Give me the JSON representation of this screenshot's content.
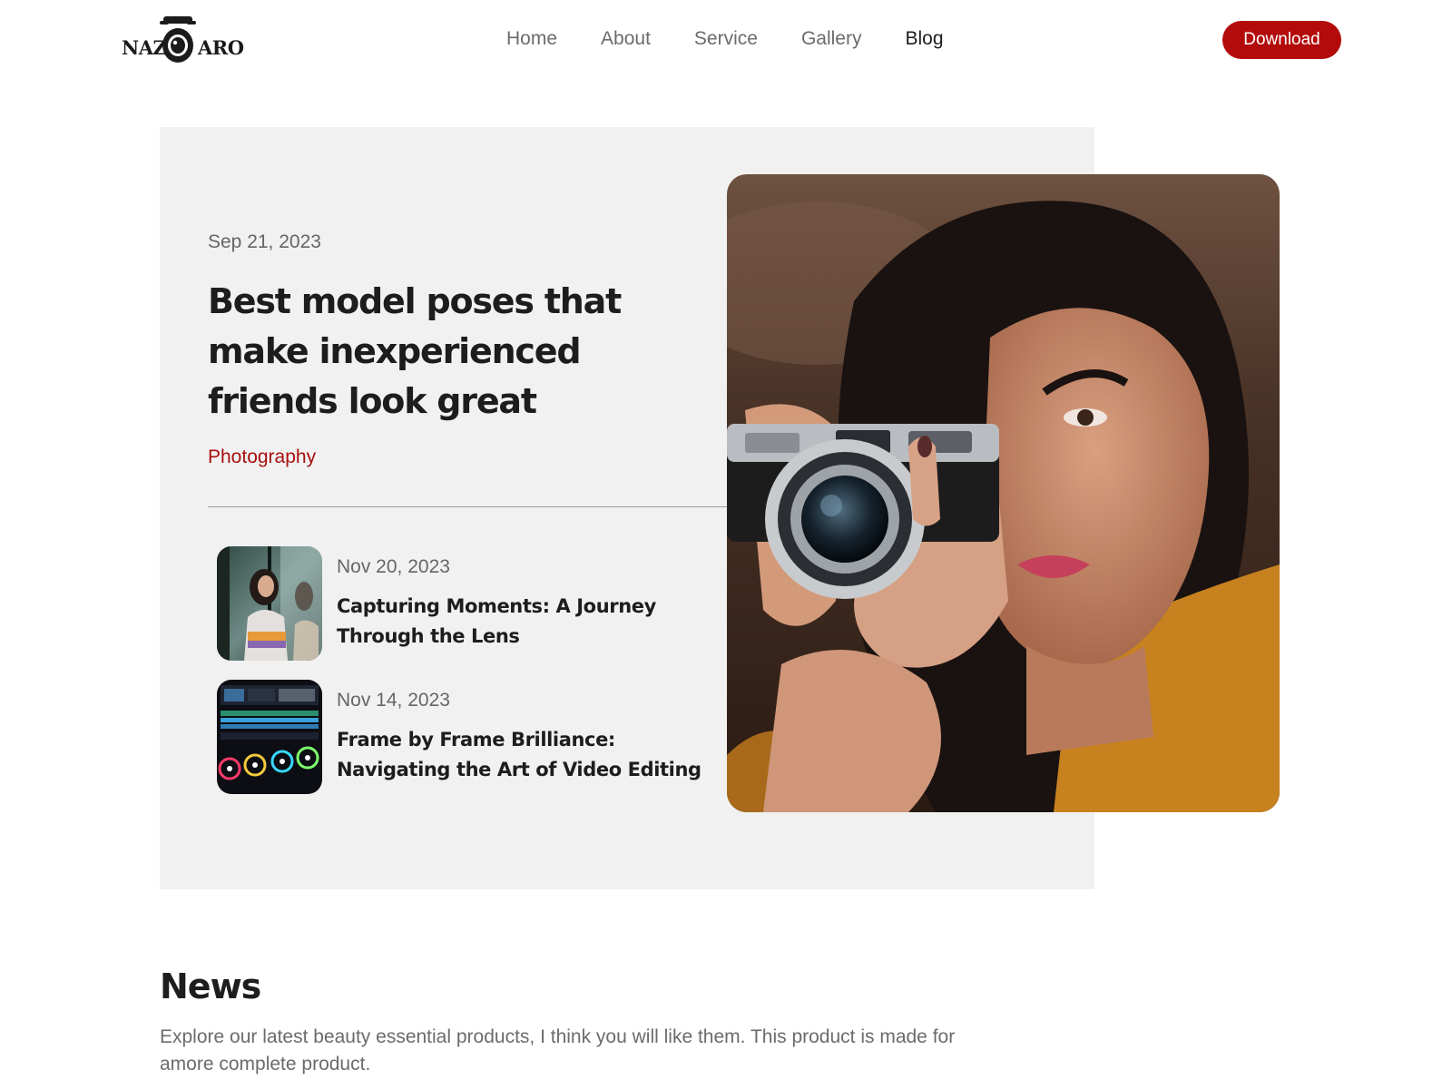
{
  "brand": {
    "logo_left": "NAZ",
    "logo_right": "ARO"
  },
  "nav": {
    "items": [
      {
        "label": "Home"
      },
      {
        "label": "About"
      },
      {
        "label": "Service"
      },
      {
        "label": "Gallery"
      },
      {
        "label": "Blog",
        "active": true
      }
    ],
    "download_label": "Download"
  },
  "hero": {
    "date": "Sep 21, 2023",
    "title": "Best model poses that make inexperienced friends look great",
    "category": "Photography",
    "image_icon": "woman-with-camera-photo"
  },
  "posts": [
    {
      "date": "Nov 20, 2023",
      "title": "Capturing Moments: A Journey Through the Lens",
      "thumb_icon": "woman-portrait-thumbnail"
    },
    {
      "date": "Nov 14, 2023",
      "title": "Frame by Frame Brilliance: Navigating the Art of Video Editing",
      "thumb_icon": "video-editing-thumbnail"
    }
  ],
  "news": {
    "title": "News",
    "description": "Explore our latest beauty essential products, I think you will like them. This product is made for amore complete product."
  },
  "colors": {
    "accent": "#b30b0b",
    "category": "#a80f0f",
    "hero_bg": "#f1f1f1",
    "text": "#1d1d1d",
    "muted": "#666666"
  }
}
